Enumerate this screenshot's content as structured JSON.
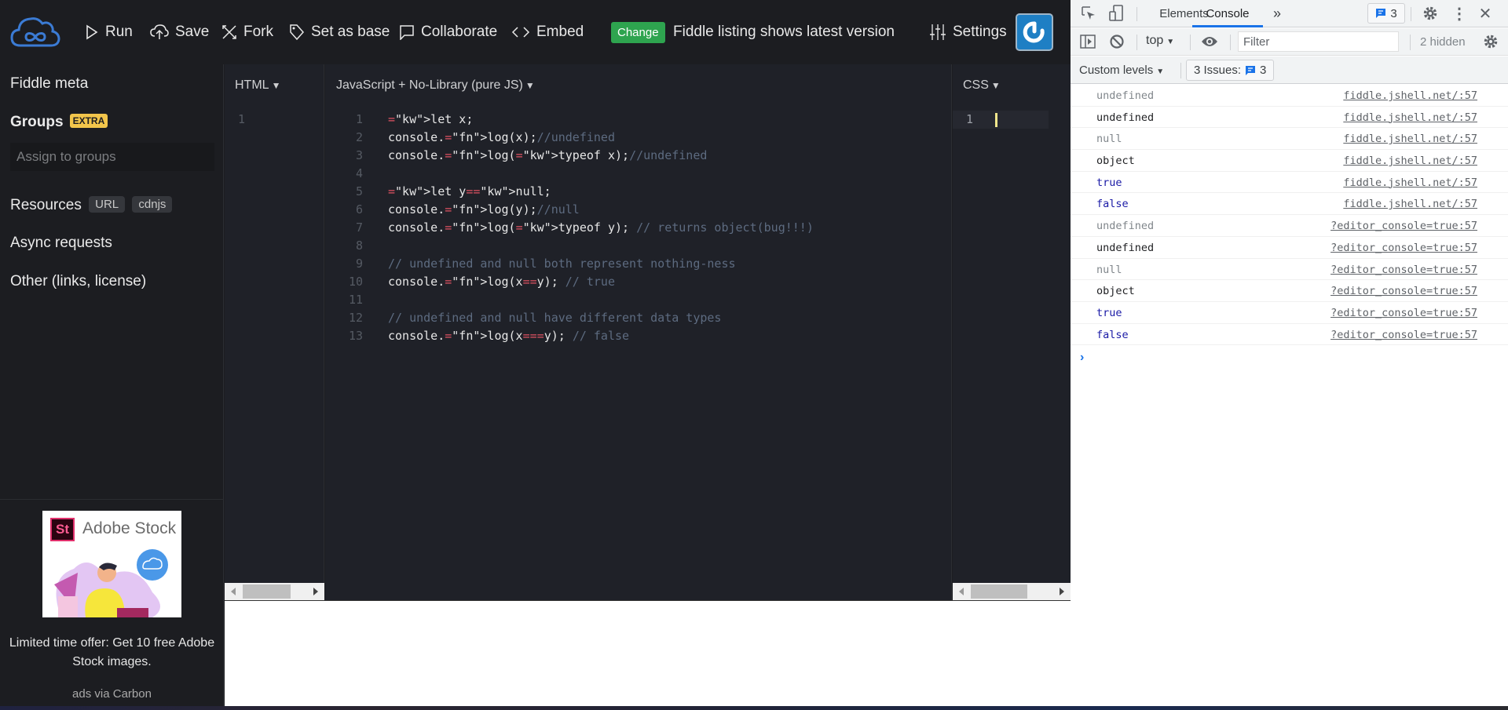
{
  "topbar": {
    "logo": "jsfiddle-cloud-logo",
    "buttons": [
      {
        "label": "Run",
        "icon": "play-icon"
      },
      {
        "label": "Save",
        "icon": "cloud-upload-icon"
      },
      {
        "label": "Fork",
        "icon": "fork-icon"
      },
      {
        "label": "Set as base",
        "icon": "tag-icon"
      },
      {
        "label": "Collaborate",
        "icon": "chat-icon"
      },
      {
        "label": "Embed",
        "icon": "code-icon"
      }
    ],
    "change_label": "Change",
    "change_message": "Fiddle listing shows latest version",
    "settings_label": "Settings",
    "power_icon": "power-icon"
  },
  "sidebar": {
    "fiddle_meta": "Fiddle meta",
    "groups": "Groups",
    "groups_badge": "EXTRA",
    "assign_placeholder": "Assign to groups",
    "resources": "Resources",
    "resources_pills": [
      "URL",
      "cdnjs"
    ],
    "async_requests": "Async requests",
    "other": "Other (links, license)",
    "ad": {
      "brand": "Adobe Stock",
      "brand_mark": "St",
      "text": "Limited time offer: Get 10 free Adobe Stock images.",
      "via": "ads via Carbon"
    }
  },
  "editors": {
    "html": {
      "title": "HTML",
      "lines": [
        "1"
      ]
    },
    "js": {
      "title": "JavaScript + No-Library (pure JS)",
      "code": [
        "let x;",
        "console.log(x);//undefined",
        "console.log(typeof x);//undefined",
        "",
        "let y=null;",
        "console.log(y);//null",
        "console.log(typeof y); // returns object(bug!!!)",
        "",
        "// undefined and null both represent nothing-ness",
        "console.log(x==y); // true",
        "",
        "// undefined and null have different data types",
        "console.log(x===y); // false"
      ]
    },
    "css": {
      "title": "CSS",
      "lines": [
        "1"
      ]
    }
  },
  "devtools": {
    "tabs": [
      "Elements",
      "Console"
    ],
    "active_tab": "Console",
    "more_tabs": "»",
    "message_count": "3",
    "context": "top",
    "filter_placeholder": "Filter",
    "hidden": "2 hidden",
    "levels": "Custom levels",
    "issues_label": "3 Issues:",
    "issues_count": "3",
    "console_rows": [
      {
        "value": "undefined",
        "style": "grey",
        "source": "fiddle.jshell.net/:57"
      },
      {
        "value": "undefined",
        "style": "dark",
        "source": "fiddle.jshell.net/:57"
      },
      {
        "value": "null",
        "style": "grey",
        "source": "fiddle.jshell.net/:57"
      },
      {
        "value": "object",
        "style": "dark",
        "source": "fiddle.jshell.net/:57"
      },
      {
        "value": "true",
        "style": "blue",
        "source": "fiddle.jshell.net/:57"
      },
      {
        "value": "false",
        "style": "blue",
        "source": "fiddle.jshell.net/:57"
      },
      {
        "value": "undefined",
        "style": "grey",
        "source": "?editor_console=true:57"
      },
      {
        "value": "undefined",
        "style": "dark",
        "source": "?editor_console=true:57"
      },
      {
        "value": "null",
        "style": "grey",
        "source": "?editor_console=true:57"
      },
      {
        "value": "object",
        "style": "dark",
        "source": "?editor_console=true:57"
      },
      {
        "value": "true",
        "style": "blue",
        "source": "?editor_console=true:57"
      },
      {
        "value": "false",
        "style": "blue",
        "source": "?editor_console=true:57"
      }
    ],
    "prompt": "›"
  },
  "colors": {
    "accent_blue": "#1e7fc4",
    "change_green": "#2ea44f",
    "extra_badge": "#f2c54b",
    "devtools_active_tab": "#1a73e8"
  }
}
